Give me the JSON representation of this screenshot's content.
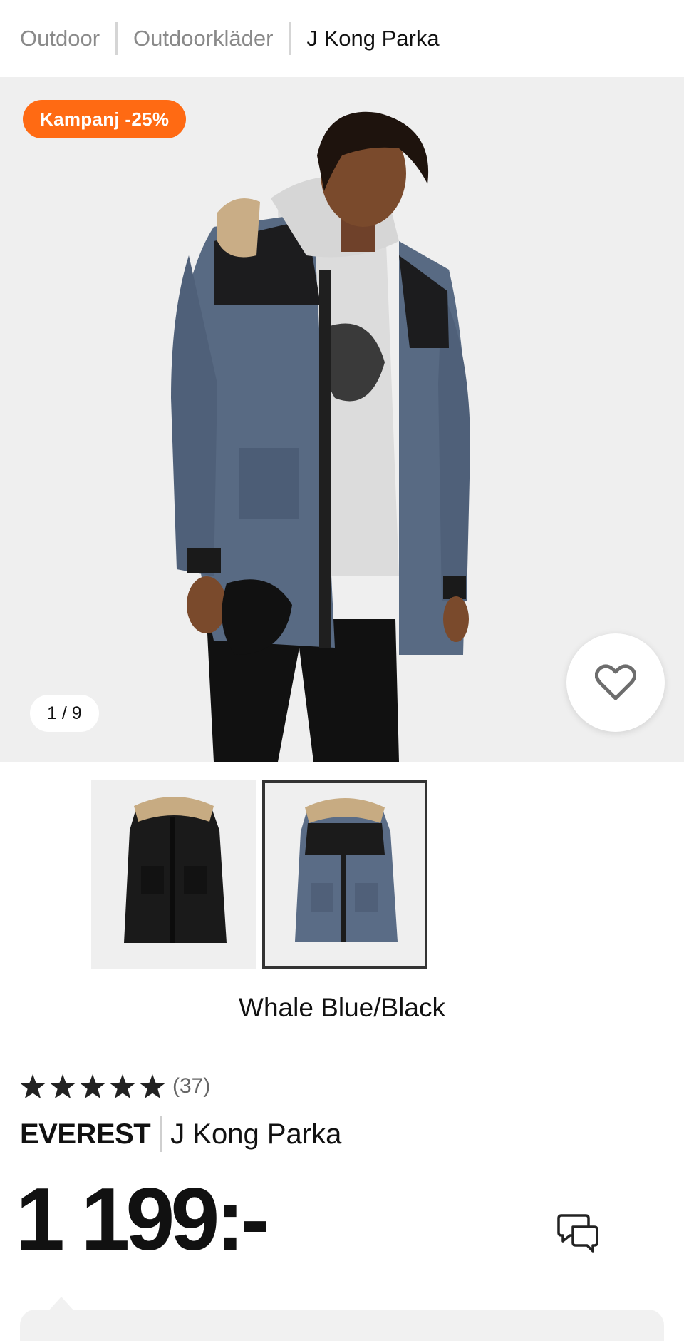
{
  "breadcrumb": {
    "items": [
      "Outdoor",
      "Outdoorkläder"
    ],
    "current": "J Kong Parka"
  },
  "hero": {
    "badge": "Kampanj -25%",
    "counter": "1 / 9",
    "favorite_icon": "heart-outline-icon"
  },
  "colors": {
    "selected_name": "Whale Blue/Black",
    "thumbnails": [
      "black-parka",
      "whale-blue-black-parka"
    ]
  },
  "rating": {
    "stars": 5,
    "count": "(37)"
  },
  "product": {
    "brand": "EVEREST",
    "name": "J Kong Parka",
    "price": "1 199:-"
  },
  "actions": {
    "chat_icon": "chat-bubbles-icon"
  },
  "theme": {
    "accent": "#ff6a13",
    "background": "#efefef"
  }
}
